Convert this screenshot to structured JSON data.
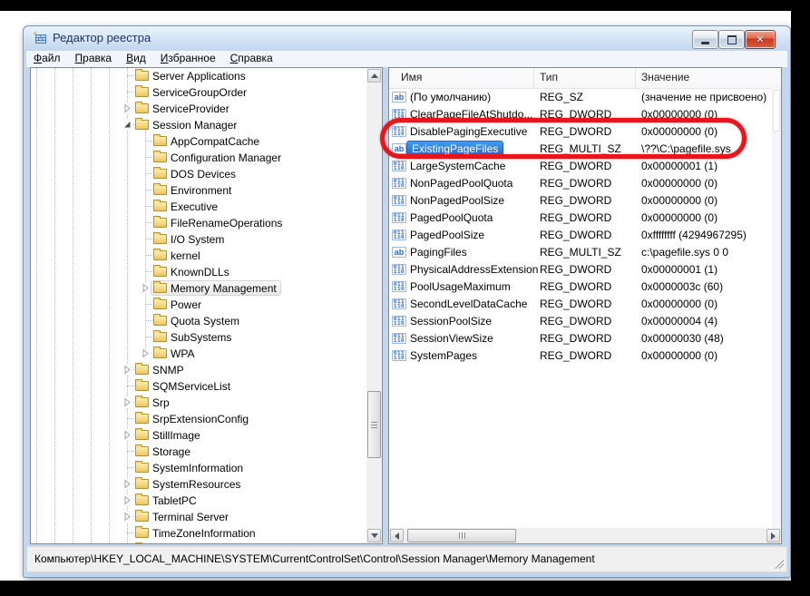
{
  "window": {
    "title": "Редактор реестра"
  },
  "titlebar": {
    "buttons": [
      "minimize",
      "maximize",
      "close"
    ]
  },
  "menu": {
    "items": [
      "Файл",
      "Правка",
      "Вид",
      "Избранное",
      "Справка"
    ]
  },
  "tree": {
    "items": [
      {
        "label": "Server Applications",
        "level": 0,
        "expander": "none"
      },
      {
        "label": "ServiceGroupOrder",
        "level": 0,
        "expander": "none"
      },
      {
        "label": "ServiceProvider",
        "level": 0,
        "expander": "collapsed"
      },
      {
        "label": "Session Manager",
        "level": 0,
        "expander": "expanded"
      },
      {
        "label": "AppCompatCache",
        "level": 1,
        "expander": "none"
      },
      {
        "label": "Configuration Manager",
        "level": 1,
        "expander": "none"
      },
      {
        "label": "DOS Devices",
        "level": 1,
        "expander": "none"
      },
      {
        "label": "Environment",
        "level": 1,
        "expander": "none"
      },
      {
        "label": "Executive",
        "level": 1,
        "expander": "none"
      },
      {
        "label": "FileRenameOperations",
        "level": 1,
        "expander": "none"
      },
      {
        "label": "I/O System",
        "level": 1,
        "expander": "none"
      },
      {
        "label": "kernel",
        "level": 1,
        "expander": "none"
      },
      {
        "label": "KnownDLLs",
        "level": 1,
        "expander": "none"
      },
      {
        "label": "Memory Management",
        "level": 1,
        "expander": "collapsed",
        "selected": true
      },
      {
        "label": "Power",
        "level": 1,
        "expander": "none"
      },
      {
        "label": "Quota System",
        "level": 1,
        "expander": "none"
      },
      {
        "label": "SubSystems",
        "level": 1,
        "expander": "none"
      },
      {
        "label": "WPA",
        "level": 1,
        "expander": "collapsed"
      },
      {
        "label": "SNMP",
        "level": 0,
        "expander": "collapsed"
      },
      {
        "label": "SQMServiceList",
        "level": 0,
        "expander": "none"
      },
      {
        "label": "Srp",
        "level": 0,
        "expander": "collapsed"
      },
      {
        "label": "SrpExtensionConfig",
        "level": 0,
        "expander": "none"
      },
      {
        "label": "StillImage",
        "level": 0,
        "expander": "collapsed"
      },
      {
        "label": "Storage",
        "level": 0,
        "expander": "none"
      },
      {
        "label": "SystemInformation",
        "level": 0,
        "expander": "none"
      },
      {
        "label": "SystemResources",
        "level": 0,
        "expander": "collapsed"
      },
      {
        "label": "TabletPC",
        "level": 0,
        "expander": "collapsed"
      },
      {
        "label": "Terminal Server",
        "level": 0,
        "expander": "collapsed"
      },
      {
        "label": "TimeZoneInformation",
        "level": 0,
        "expander": "none"
      },
      {
        "label": "",
        "level": 0,
        "expander": "none",
        "partial": true
      }
    ]
  },
  "list": {
    "columns": [
      "Имя",
      "Тип",
      "Значение"
    ],
    "rows": [
      {
        "name": "(По умолчанию)",
        "type": "REG_SZ",
        "value": "(значение не присвоено)",
        "icon": "string"
      },
      {
        "name": "ClearPageFileAtShutdo...",
        "type": "REG_DWORD",
        "value": "0x00000000 (0)",
        "icon": "dword"
      },
      {
        "name": "DisablePagingExecutive",
        "type": "REG_DWORD",
        "value": "0x00000000 (0)",
        "icon": "dword"
      },
      {
        "name": "ExistingPageFiles",
        "type": "REG_MULTI_SZ",
        "value": "\\??\\C:\\pagefile.sys",
        "icon": "string",
        "selected": true,
        "circled": true
      },
      {
        "name": "LargeSystemCache",
        "type": "REG_DWORD",
        "value": "0x00000001 (1)",
        "icon": "dword"
      },
      {
        "name": "NonPagedPoolQuota",
        "type": "REG_DWORD",
        "value": "0x00000000 (0)",
        "icon": "dword"
      },
      {
        "name": "NonPagedPoolSize",
        "type": "REG_DWORD",
        "value": "0x00000000 (0)",
        "icon": "dword"
      },
      {
        "name": "PagedPoolQuota",
        "type": "REG_DWORD",
        "value": "0x00000000 (0)",
        "icon": "dword"
      },
      {
        "name": "PagedPoolSize",
        "type": "REG_DWORD",
        "value": "0xffffffff (4294967295)",
        "icon": "dword"
      },
      {
        "name": "PagingFiles",
        "type": "REG_MULTI_SZ",
        "value": "c:\\pagefile.sys 0 0",
        "icon": "string"
      },
      {
        "name": "PhysicalAddressExtension",
        "type": "REG_DWORD",
        "value": "0x00000001 (1)",
        "icon": "dword"
      },
      {
        "name": "PoolUsageMaximum",
        "type": "REG_DWORD",
        "value": "0x0000003c (60)",
        "icon": "dword"
      },
      {
        "name": "SecondLevelDataCache",
        "type": "REG_DWORD",
        "value": "0x00000000 (0)",
        "icon": "dword"
      },
      {
        "name": "SessionPoolSize",
        "type": "REG_DWORD",
        "value": "0x00000004 (4)",
        "icon": "dword"
      },
      {
        "name": "SessionViewSize",
        "type": "REG_DWORD",
        "value": "0x00000030 (48)",
        "icon": "dword"
      },
      {
        "name": "SystemPages",
        "type": "REG_DWORD",
        "value": "0x00000000 (0)",
        "icon": "dword"
      }
    ]
  },
  "statusbar": {
    "path": "Компьютер\\HKEY_LOCAL_MACHINE\\SYSTEM\\CurrentControlSet\\Control\\Session Manager\\Memory Management"
  },
  "colors": {
    "highlight_ring": "#e8151c",
    "selection_top": "#419bee",
    "selection_bottom": "#2566cd",
    "selection_border": "#2a5cb4",
    "title_text": "#1e3460",
    "folder_yellow": "#eec65f"
  }
}
